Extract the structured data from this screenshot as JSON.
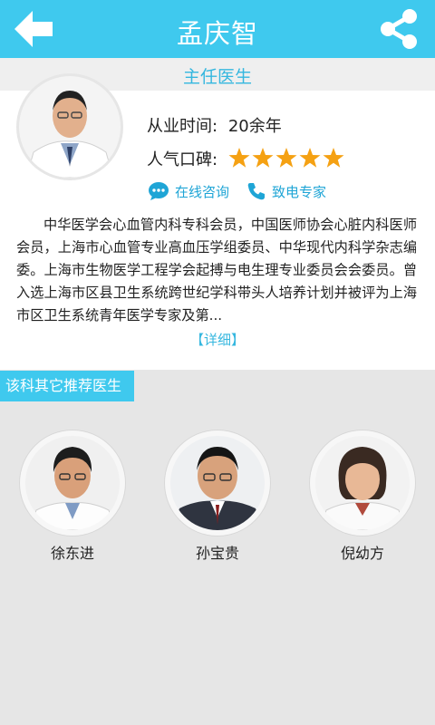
{
  "header": {
    "title": "孟庆智",
    "back_icon": "back-arrow-icon",
    "share_icon": "share-icon"
  },
  "doctor": {
    "rank": "主任医生",
    "experience_label": "从业时间:",
    "experience_value": "20余年",
    "popularity_label": "人气口碑:",
    "rating": 5,
    "consult_label": "在线咨询",
    "call_label": "致电专家",
    "bio": "中华医学会心血管内科专科会员，中国医师协会心脏内科医师会员，上海市心血管专业高血压学组委员、中华现代内科学杂志编委。上海市生物医学工程学会起搏与电生理专业委员会会委员。曾入选上海市区县卫生系统跨世纪学科带头人培养计划并被评为上海市区卫生系统青年医学专家及第...",
    "detail_label": "【详细】"
  },
  "recommend": {
    "section_title": "该科其它推荐医生",
    "doctors": [
      {
        "name": "徐东进"
      },
      {
        "name": "孙宝贵"
      },
      {
        "name": "倪幼方"
      }
    ]
  },
  "colors": {
    "accent": "#3fc9ee",
    "link": "#1fa5d6",
    "star": "#f5a113",
    "background": "#e6e6e6"
  }
}
